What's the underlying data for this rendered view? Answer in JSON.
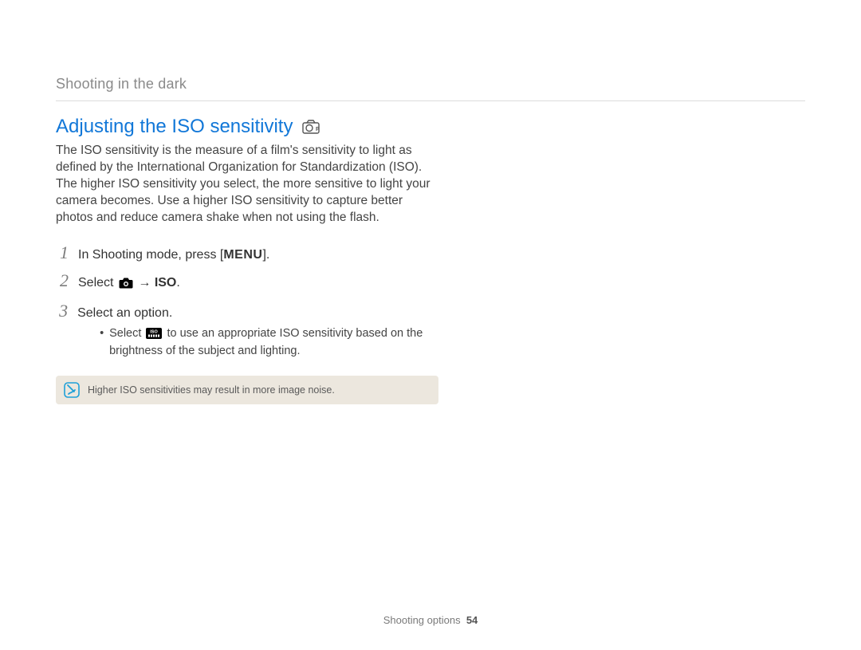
{
  "breadcrumb": "Shooting in the dark",
  "heading": "Adjusting the ISO sensitivity",
  "mode_icon": "camera-p-icon",
  "intro": "The ISO sensitivity is the measure of a film's sensitivity to light as defined by the International Organization for Standardization (ISO). The higher ISO sensitivity you select, the more sensitive to light your camera becomes. Use a higher ISO sensitivity to capture better photos and reduce camera shake when not using the flash.",
  "steps": [
    {
      "num": "1",
      "pre": "In Shooting mode, press [",
      "icon": "menu-glyph",
      "icon_text": "MENU",
      "post": "]."
    },
    {
      "num": "2",
      "pre": "Select ",
      "icon": "camera-icon",
      "post_arrow": " → ",
      "post_bold": "ISO",
      "post": "."
    },
    {
      "num": "3",
      "pre": "Select an option.",
      "bullet_pre": "Select ",
      "bullet_icon": "iso-auto-icon",
      "bullet_post": " to use an appropriate ISO sensitivity based on the brightness of the subject and lighting."
    }
  ],
  "note": {
    "icon": "note-icon",
    "text": "Higher ISO sensitivities may result in more image noise."
  },
  "footer": {
    "section": "Shooting options",
    "page": "54"
  }
}
